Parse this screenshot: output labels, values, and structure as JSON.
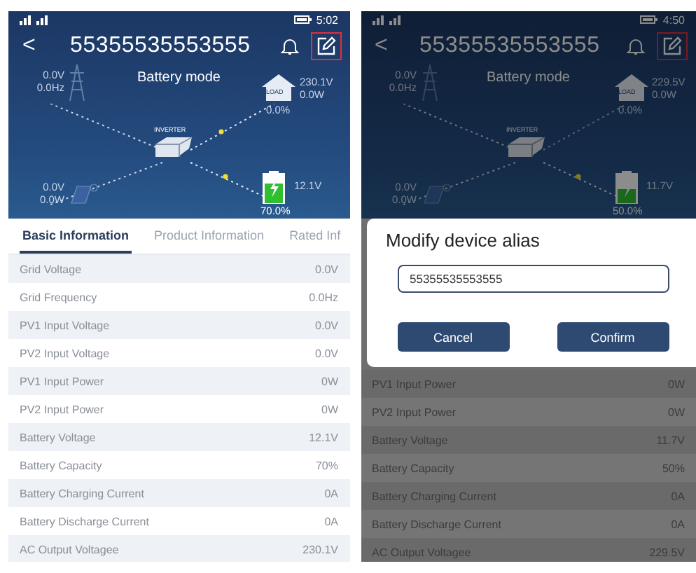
{
  "screens": [
    {
      "status_bar": {
        "time": "5:02"
      },
      "header": {
        "back": "<",
        "title": "55355535553555",
        "edit_highlighted": true
      },
      "dashboard": {
        "mode": "Battery mode",
        "grid": {
          "voltage": "0.0V",
          "frequency": "0.0Hz"
        },
        "load": {
          "label": "LOAD",
          "voltage": "230.1V",
          "power": "0.0W",
          "percent": "0.0%",
          "flowing": true
        },
        "inverter_label": "INVERTER",
        "pv": {
          "voltage": "0.0V",
          "power": "0.0W"
        },
        "battery": {
          "voltage": "12.1V",
          "percent": "70.0%",
          "level": 0.7,
          "flowing": true
        }
      },
      "tabs": [
        {
          "label": "Basic Information",
          "selected": true
        },
        {
          "label": "Product Information",
          "selected": false
        },
        {
          "label": "Rated Inf",
          "selected": false
        }
      ],
      "rows": [
        {
          "label": "Grid Voltage",
          "value": "0.0V"
        },
        {
          "label": "Grid Frequency",
          "value": "0.0Hz"
        },
        {
          "label": "PV1 Input Voltage",
          "value": "0.0V"
        },
        {
          "label": "PV2 Input Voltage",
          "value": "0.0V"
        },
        {
          "label": "PV1 Input Power",
          "value": "0W"
        },
        {
          "label": "PV2 Input Power",
          "value": "0W"
        },
        {
          "label": "Battery Voltage",
          "value": "12.1V"
        },
        {
          "label": "Battery Capacity",
          "value": "70%"
        },
        {
          "label": "Battery Charging Current",
          "value": "0A"
        },
        {
          "label": "Battery Discharge Current",
          "value": "0A"
        },
        {
          "label": "AC Output Voltagee",
          "value": "230.1V"
        }
      ]
    },
    {
      "status_bar": {
        "time": "4:50"
      },
      "header": {
        "back": "<",
        "title": "55355535553555",
        "edit_highlighted": true
      },
      "dashboard": {
        "mode": "Battery mode",
        "grid": {
          "voltage": "0.0V",
          "frequency": "0.0Hz"
        },
        "load": {
          "label": "LOAD",
          "voltage": "229.5V",
          "power": "0.0W",
          "percent": "0.0%",
          "flowing": false
        },
        "inverter_label": "INVERTER",
        "pv": {
          "voltage": "0.0V",
          "power": "0.0W"
        },
        "battery": {
          "voltage": "11.7V",
          "percent": "50.0%",
          "level": 0.5,
          "flowing": true
        }
      },
      "dialog": {
        "title": "Modify device alias",
        "input_value": "55355535553555",
        "buttons": [
          {
            "kind": "cancel",
            "label": "Cancel"
          },
          {
            "kind": "confirm",
            "label": "Confirm"
          }
        ]
      },
      "rows": [
        {
          "label": "PV1 Input Power",
          "value": "0W"
        },
        {
          "label": "PV2 Input Power",
          "value": "0W"
        },
        {
          "label": "Battery Voltage",
          "value": "11.7V"
        },
        {
          "label": "Battery Capacity",
          "value": "50%"
        },
        {
          "label": "Battery Charging Current",
          "value": "0A"
        },
        {
          "label": "Battery Discharge Current",
          "value": "0A"
        },
        {
          "label": "AC Output Voltagee",
          "value": "229.5V"
        }
      ]
    }
  ]
}
